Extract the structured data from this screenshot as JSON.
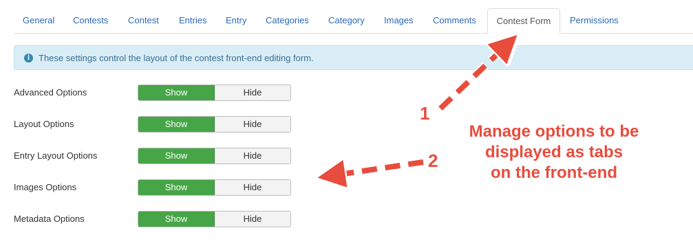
{
  "tabs": [
    {
      "label": "General",
      "active": false
    },
    {
      "label": "Contests",
      "active": false
    },
    {
      "label": "Contest",
      "active": false
    },
    {
      "label": "Entries",
      "active": false
    },
    {
      "label": "Entry",
      "active": false
    },
    {
      "label": "Categories",
      "active": false
    },
    {
      "label": "Category",
      "active": false
    },
    {
      "label": "Images",
      "active": false
    },
    {
      "label": "Comments",
      "active": false
    },
    {
      "label": "Contest Form",
      "active": true
    },
    {
      "label": "Permissions",
      "active": false
    }
  ],
  "alert": {
    "icon": "info-icon",
    "text": "These settings control the layout of the contest front-end editing form."
  },
  "options": [
    {
      "label": "Advanced Options",
      "show_label": "Show",
      "hide_label": "Hide",
      "selected": "Show"
    },
    {
      "label": "Layout Options",
      "show_label": "Show",
      "hide_label": "Hide",
      "selected": "Show"
    },
    {
      "label": "Entry Layout Options",
      "show_label": "Show",
      "hide_label": "Hide",
      "selected": "Show"
    },
    {
      "label": "Images Options",
      "show_label": "Show",
      "hide_label": "Hide",
      "selected": "Show"
    },
    {
      "label": "Metadata Options",
      "show_label": "Show",
      "hide_label": "Hide",
      "selected": "Show"
    }
  ],
  "annotation": {
    "marker_1": "1",
    "marker_2": "2",
    "callout_line_1": "Manage options to be",
    "callout_line_2": "displayed as tabs",
    "callout_line_3": "on the front-end"
  },
  "colors": {
    "link": "#2a69b8",
    "show_active": "#46a546",
    "alert_bg": "#d9edf7",
    "annotation": "#e84c3d"
  }
}
